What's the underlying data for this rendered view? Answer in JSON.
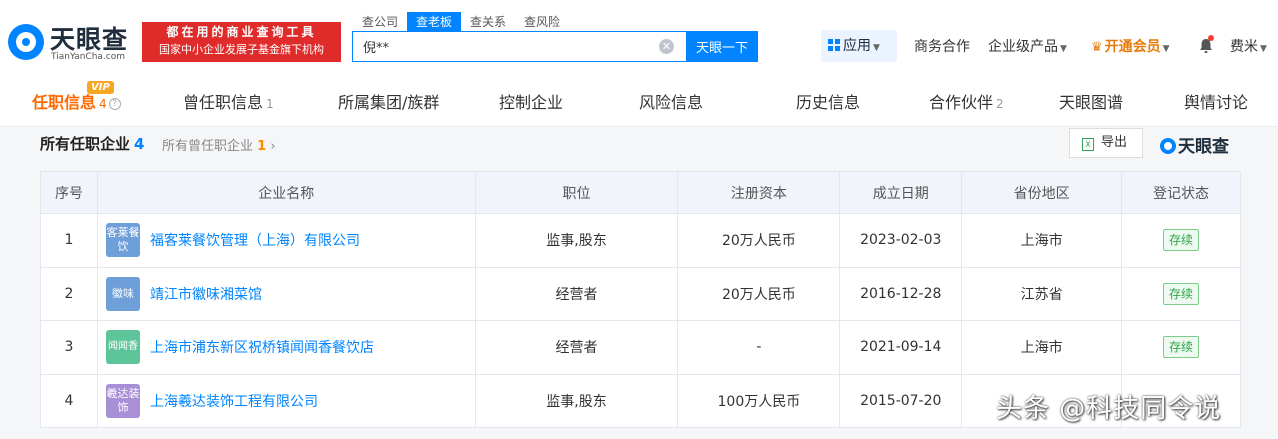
{
  "brand": {
    "name": "天眼查",
    "domain": "TianYanCha.com"
  },
  "slogan": {
    "line1": "都在用的商业查询工具",
    "line2": "国家中小企业发展子基金旗下机构"
  },
  "search": {
    "tabs": [
      "查公司",
      "查老板",
      "查关系",
      "查风险"
    ],
    "active_tab": "查老板",
    "value": "倪**",
    "clear_icon": "✕",
    "button": "天眼一下"
  },
  "nav": {
    "app": "应用",
    "business": "商务合作",
    "enterprise": "企业级产品",
    "vip": "开通会员",
    "user": "费米"
  },
  "tabs": [
    {
      "label": "任职信息",
      "count": "4",
      "badge": "VIP"
    },
    {
      "label": "曾任职信息",
      "count": "1"
    },
    {
      "label": "所属集团/族群",
      "count": ""
    },
    {
      "label": "控制企业",
      "count": ""
    },
    {
      "label": "风险信息",
      "count": ""
    },
    {
      "label": "历史信息",
      "count": ""
    },
    {
      "label": "合作伙伴",
      "count": "2"
    },
    {
      "label": "天眼图谱",
      "count": ""
    },
    {
      "label": "舆情讨论",
      "count": ""
    }
  ],
  "section": {
    "title": "所有任职企业",
    "count": "4",
    "past_label": "所有曾任职企业",
    "past_count": "1",
    "export": "导出",
    "watermark": "天眼查"
  },
  "table": {
    "headers": [
      "序号",
      "企业名称",
      "职位",
      "注册资本",
      "成立日期",
      "省份地区",
      "登记状态"
    ],
    "rows": [
      {
        "no": "1",
        "avatar": "客莱餐饮",
        "avatar_color": "#6f9fd8",
        "name": "福客莱餐饮管理（上海）有限公司",
        "position": "监事,股东",
        "capital": "20万人民币",
        "date": "2023-02-03",
        "region": "上海市",
        "status": "存续"
      },
      {
        "no": "2",
        "avatar": "徽味",
        "avatar_color": "#6f9fd8",
        "name": "靖江市徽味湘菜馆",
        "position": "经营者",
        "capital": "20万人民币",
        "date": "2016-12-28",
        "region": "江苏省",
        "status": "存续"
      },
      {
        "no": "3",
        "avatar": "闻闻香",
        "avatar_color": "#5ec49a",
        "name": "上海市浦东新区祝桥镇闻闻香餐饮店",
        "position": "经营者",
        "capital": "-",
        "date": "2021-09-14",
        "region": "上海市",
        "status": "存续"
      },
      {
        "no": "4",
        "avatar": "羲达装饰",
        "avatar_color": "#a98fd6",
        "name": "上海羲达装饰工程有限公司",
        "position": "监事,股东",
        "capital": "100万人民币",
        "date": "2015-07-20",
        "region": "",
        "status": ""
      }
    ]
  },
  "overlay": "头条 @科技同令说"
}
